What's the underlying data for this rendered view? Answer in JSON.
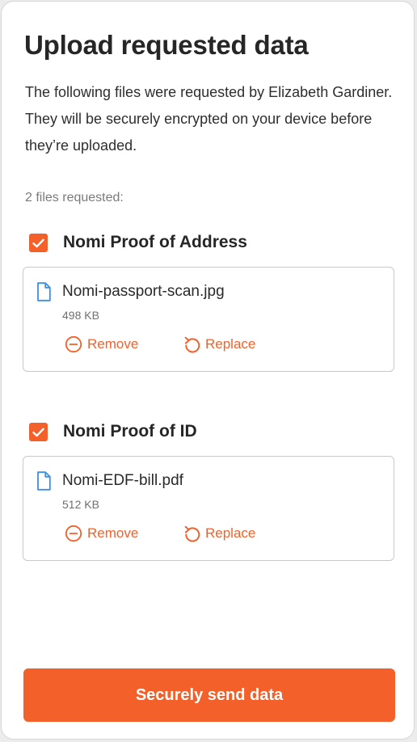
{
  "page": {
    "title": "Upload requested data",
    "description": "The following files were requested by Elizabeth Gardiner. They will be securely encrypted on your device before they’re uploaded.",
    "files_requested_label": "2 files requested:"
  },
  "requests": [
    {
      "checked": true,
      "title": "Nomi Proof of Address",
      "file": {
        "name": "Nomi-passport-scan.jpg",
        "size": "498 KB",
        "icon": "file-icon"
      },
      "remove_label": "Remove",
      "replace_label": "Replace"
    },
    {
      "checked": true,
      "title": "Nomi Proof of ID",
      "file": {
        "name": "Nomi-EDF-bill.pdf",
        "size": "512 KB",
        "icon": "file-icon"
      },
      "remove_label": "Remove",
      "replace_label": "Replace"
    }
  ],
  "primary_button": {
    "label": "Securely send data"
  },
  "colors": {
    "accent": "#f4602a",
    "file_icon": "#3b8fe6",
    "background": "#ffffff",
    "page_background": "#ececec"
  }
}
